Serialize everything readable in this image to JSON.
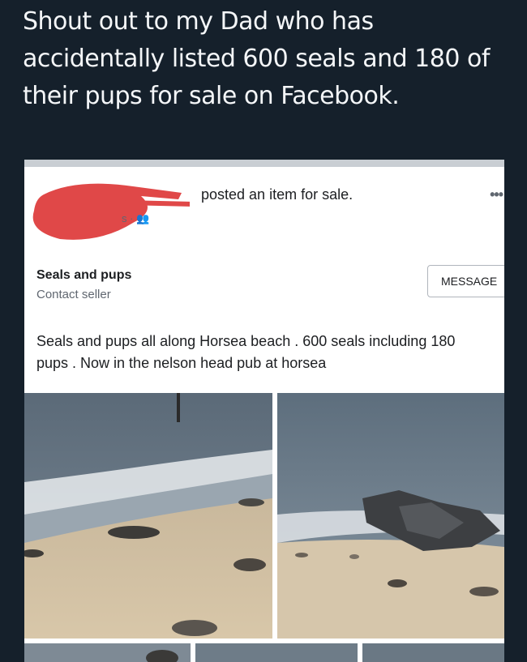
{
  "tweet": {
    "text": "Shout out to my Dad who has accidentally listed 600 seals and 180 of their pups for sale on Facebook."
  },
  "post": {
    "action_text": "posted an item for sale.",
    "more_icon": "ellipsis-icon",
    "meta_suffix": "s ·",
    "audience_icon": "friends-icon"
  },
  "listing": {
    "title": "Seals and pups",
    "contact_label": "Contact seller",
    "message_button": "MESSAGE",
    "description": [
      "Seals and pups all along Horsea beach . 600 seals including 180",
      "pups . Now in the nelson head pub at horsea"
    ]
  },
  "colors": {
    "page_bg": "#15202b",
    "redaction": "#e04848",
    "card_bg": "#ffffff"
  }
}
